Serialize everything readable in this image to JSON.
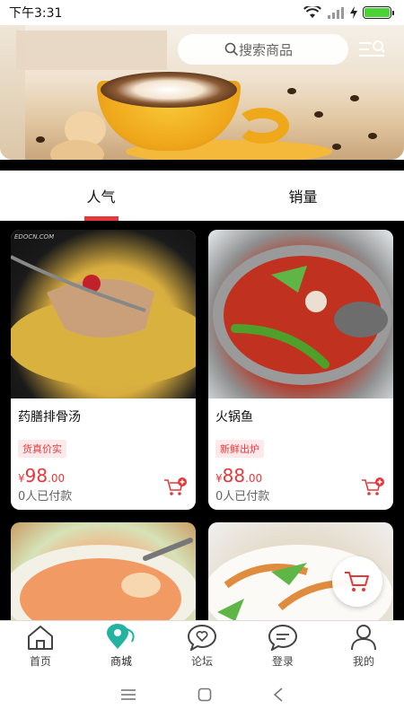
{
  "status_bar": {
    "time": "下午3:31"
  },
  "header": {
    "search_placeholder": "搜索商品"
  },
  "tabs": [
    {
      "label": "人气"
    },
    {
      "label": "销量"
    }
  ],
  "products": [
    {
      "name": "药膳排骨汤",
      "tag": "货真价实",
      "currency": "¥",
      "price_int": "98",
      "price_dec": ".00",
      "sold": "0人已付款"
    },
    {
      "name": "火锅鱼",
      "tag": "新鲜出炉",
      "currency": "¥",
      "price_int": "88",
      "price_dec": ".00",
      "sold": "0人已付款"
    }
  ],
  "watermark": "EDOCN.COM",
  "bottom_nav": [
    {
      "label": "首页",
      "icon": "home-icon"
    },
    {
      "label": "商城",
      "icon": "location-pin-icon"
    },
    {
      "label": "论坛",
      "icon": "chat-heart-icon"
    },
    {
      "label": "登录",
      "icon": "chat-bubble-icon"
    },
    {
      "label": "我的",
      "icon": "user-icon"
    }
  ],
  "colors": {
    "accent": "#e4393c",
    "active_nav": "#23b3a1"
  }
}
